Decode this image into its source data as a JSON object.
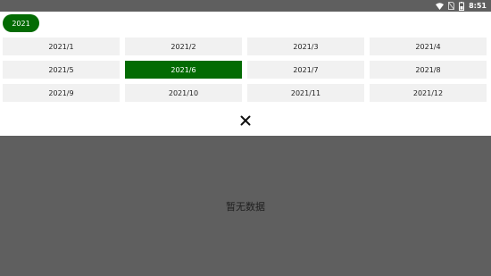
{
  "status_bar": {
    "time": "8:51",
    "icons": [
      "wifi-icon",
      "no-sim-icon",
      "battery-icon"
    ]
  },
  "year_selector": {
    "label": "2021"
  },
  "months": [
    "2021/1",
    "2021/2",
    "2021/3",
    "2021/4",
    "2021/5",
    "2021/6",
    "2021/7",
    "2021/8",
    "2021/9",
    "2021/10",
    "2021/11",
    "2021/12"
  ],
  "selected_month": "2021/6",
  "close_icon": "close-icon",
  "empty_state": {
    "text": "暂无数据"
  },
  "colors": {
    "accent": "#036b03",
    "cell_background": "#f1f1f1",
    "overlay": "#5f5f5f"
  }
}
